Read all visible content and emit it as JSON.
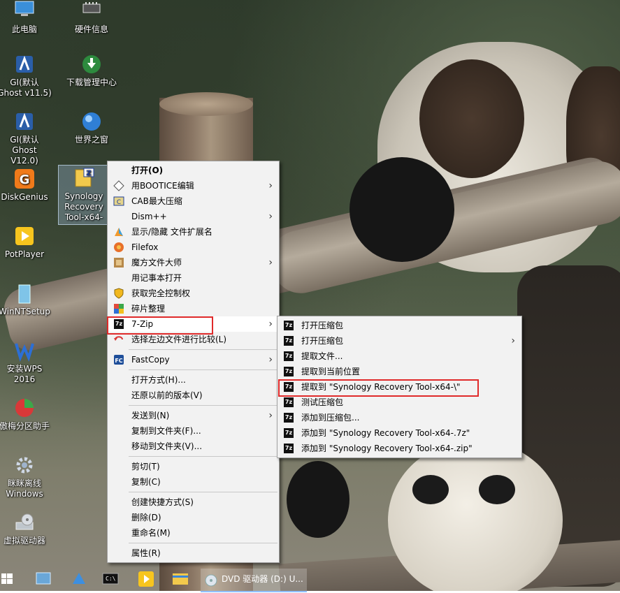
{
  "desktop_icons": [
    {
      "label": "此电脑",
      "icon": "computer-icon"
    },
    {
      "label": "硬件信息",
      "icon": "hardware-icon"
    },
    {
      "label": "GI(默认 Ghost v11.5)",
      "icon": "ghost-icon"
    },
    {
      "label": "下载管理中心",
      "icon": "download-icon"
    },
    {
      "label": "GI(默认 Ghost V12.0)",
      "icon": "ghost-icon"
    },
    {
      "label": "世界之窗",
      "icon": "browser-icon"
    },
    {
      "label": "DiskGenius",
      "icon": "diskgenius-icon"
    },
    {
      "label": "Synology Recovery Tool-x64-",
      "icon": "zip-archive-icon"
    },
    {
      "label": "PotPlayer",
      "icon": "potplayer-icon"
    },
    {
      "label": "WinNTSetup",
      "icon": "winntsetup-icon"
    },
    {
      "label": "安装WPS 2016",
      "icon": "wps-icon"
    },
    {
      "label": "傲梅分区助手",
      "icon": "partition-icon"
    },
    {
      "label": "眯眯离线 Windows",
      "icon": "gear-icon"
    },
    {
      "label": "虚拟驱动器",
      "icon": "virtual-drive-icon"
    }
  ],
  "context_menu": {
    "items": [
      {
        "label": "打开(O)",
        "icon": "",
        "bold": true
      },
      {
        "label": "用BOOTICE编辑",
        "icon": "bootice-icon",
        "submenu": true
      },
      {
        "label": "CAB最大压缩",
        "icon": "cab-icon"
      },
      {
        "label": "Dism++",
        "icon": "",
        "submenu": true
      },
      {
        "label": "显示/隐藏 文件扩展名",
        "icon": "extension-icon"
      },
      {
        "label": "Filefox",
        "icon": "filefox-icon"
      },
      {
        "label": "魔方文件大师",
        "icon": "mofang-icon",
        "submenu": true
      },
      {
        "label": "用记事本打开",
        "icon": ""
      },
      {
        "label": "获取完全控制权",
        "icon": "shield-icon"
      },
      {
        "label": "碎片整理",
        "icon": "defrag-icon"
      },
      {
        "label": "7-Zip",
        "icon": "7zip-icon",
        "submenu": true,
        "highlighted": true
      },
      {
        "label": "选择左边文件进行比较(L)",
        "icon": "compare-icon"
      },
      {
        "label": "FastCopy",
        "icon": "fastcopy-icon",
        "submenu": true
      },
      {
        "label": "打开方式(H)...",
        "icon": ""
      },
      {
        "label": "还原以前的版本(V)",
        "icon": ""
      },
      {
        "label": "发送到(N)",
        "icon": "",
        "submenu": true
      },
      {
        "label": "复制到文件夹(F)...",
        "icon": ""
      },
      {
        "label": "移动到文件夹(V)...",
        "icon": ""
      },
      {
        "label": "剪切(T)",
        "icon": ""
      },
      {
        "label": "复制(C)",
        "icon": ""
      },
      {
        "label": "创建快捷方式(S)",
        "icon": ""
      },
      {
        "label": "删除(D)",
        "icon": ""
      },
      {
        "label": "重命名(M)",
        "icon": ""
      },
      {
        "label": "属性(R)",
        "icon": ""
      }
    ]
  },
  "submenu_7zip": {
    "items": [
      {
        "label": "打开压缩包"
      },
      {
        "label": "打开压缩包",
        "submenu": true
      },
      {
        "label": "提取文件..."
      },
      {
        "label": "提取到当前位置"
      },
      {
        "label": "提取到 \"Synology Recovery Tool-x64-\\\"",
        "highlighted": true
      },
      {
        "label": "测试压缩包"
      },
      {
        "label": "添加到压缩包..."
      },
      {
        "label": "添加到 \"Synology Recovery Tool-x64-.7z\""
      },
      {
        "label": "添加到 \"Synology Recovery Tool-x64-.zip\""
      }
    ],
    "icon_text": "7z"
  },
  "taskbar": {
    "window_title": "DVD 驱动器 (D:) U...",
    "pinned": [
      "start-icon",
      "network-icon",
      "app-icon",
      "cmd-icon",
      "potplayer-icon",
      "explorer-icon"
    ]
  },
  "colors": {
    "highlight_box": "#e02a2a",
    "menu_bg": "#f2f2f2"
  }
}
